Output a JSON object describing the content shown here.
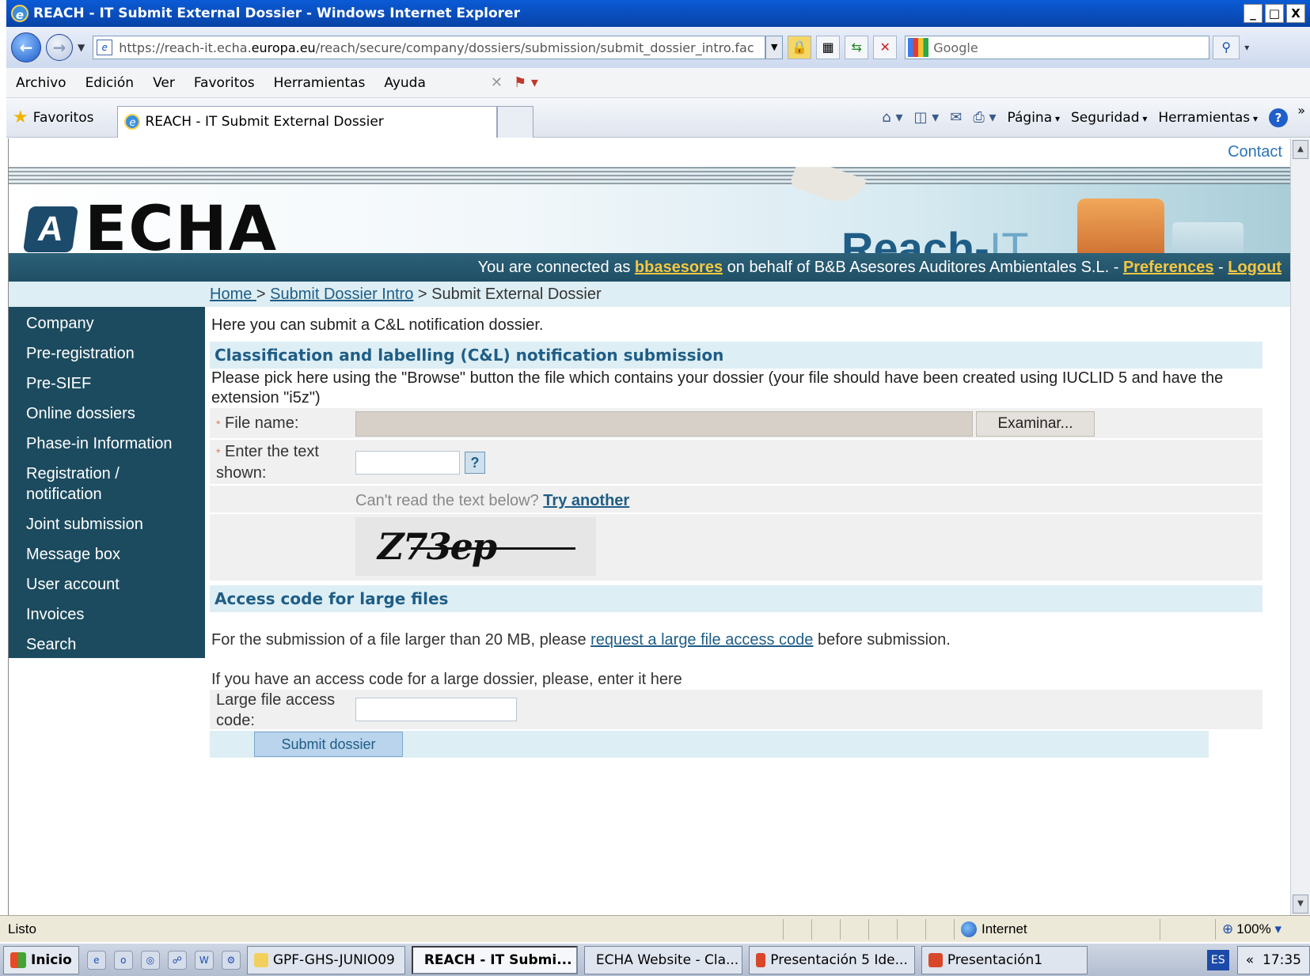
{
  "window": {
    "title": "REACH - IT Submit External Dossier - Windows Internet Explorer",
    "controls": [
      "_",
      "□",
      "X"
    ]
  },
  "address": {
    "url_prefix": "https://reach-it.echa.",
    "url_domain": "europa.eu",
    "url_suffix": "/reach/secure/company/dossiers/submission/submit_dossier_intro.fac",
    "search_placeholder": "Google"
  },
  "menu": [
    "Archivo",
    "Edición",
    "Ver",
    "Favoritos",
    "Herramientas",
    "Ayuda"
  ],
  "favbar": {
    "favorites_label": "Favoritos",
    "tab_title": "REACH - IT Submit External Dossier",
    "commands": [
      "Página",
      "Seguridad",
      "Herramientas"
    ]
  },
  "page": {
    "contact": "Contact",
    "logo_text": "ECHA",
    "reachit_main": "Reach-",
    "reachit_it": "IT",
    "connected_prefix": "You are connected as ",
    "user": "bbasesores",
    "connected_mid": " on behalf of B&B Asesores Auditores Ambientales S.L. - ",
    "preferences": "Preferences",
    "sep": " - ",
    "logout": "Logout",
    "breadcrumb": {
      "home": "Home ",
      "sep1": " > ",
      "intro": "Submit Dossier Intro",
      "sep2": " > ",
      "current": "Submit External Dossier"
    },
    "sidebar": [
      "Company",
      "Pre-registration",
      "Pre-SIEF",
      "Online dossiers",
      "Phase-in Information",
      "Registration / notification",
      "Joint submission",
      "Message box",
      "User account",
      "Invoices",
      "Search"
    ],
    "intro_text": "Here you can submit a C&L notification dossier.",
    "section1": "Classification and labelling (C&L) notification submission",
    "desc": "Please pick here using the \"Browse\" button the file which contains your dossier (your file should have been created using IUCLID 5 and have the extension \"i5z\")",
    "required_mark": "*",
    "file_name_label": "File name:",
    "browse_button": "Examinar...",
    "captcha_label": "Enter the text shown:",
    "help_q": "?",
    "cant_read": "Can't read the text below? ",
    "try_another": "Try another",
    "captcha_text": "Z73ep",
    "section2": "Access code for large files",
    "large_text_pre": "For the submission of a file larger than 20 MB, please ",
    "large_link": "request a large file access code",
    "large_text_post": " before submission.",
    "access_intro": "If you have an access code for a large dossier, please, enter it here",
    "access_label": "Large file access code:",
    "submit_button": "Submit dossier"
  },
  "status": {
    "ready": "Listo",
    "zone": "Internet",
    "zoom": "100%"
  },
  "taskbar": {
    "start": "Inicio",
    "buttons": [
      "GPF-GHS-JUNIO09",
      "REACH - IT Submi...",
      "ECHA Website - Cla...",
      "Presentación 5 Ide...",
      "Presentación1"
    ],
    "lang": "ES",
    "time": "17:35"
  }
}
